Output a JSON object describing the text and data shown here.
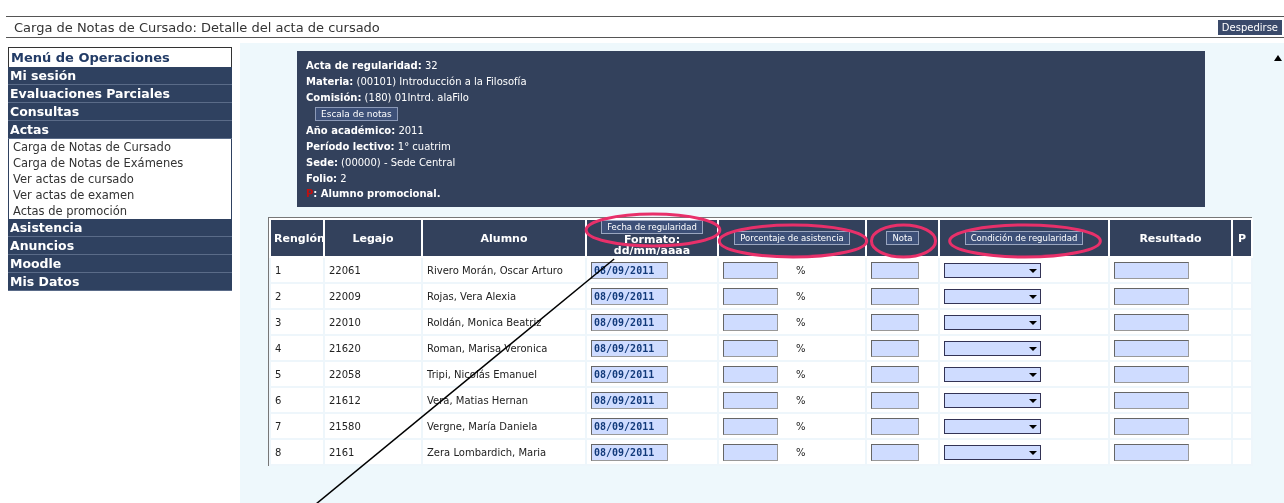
{
  "page": {
    "title": "Carga de Notas de Cursado: Detalle del acta de cursado",
    "logout_button": "Despedirse"
  },
  "sidebar": {
    "heading": "Menú de Operaciones",
    "items": [
      {
        "label": "Mi sesión",
        "kind": "section"
      },
      {
        "label": "Evaluaciones Parciales",
        "kind": "section"
      },
      {
        "label": "Consultas",
        "kind": "section"
      },
      {
        "label": "Actas",
        "kind": "section"
      },
      {
        "label": "Carga de Notas de Cursado",
        "kind": "link"
      },
      {
        "label": "Carga de Notas de Exámenes",
        "kind": "link"
      },
      {
        "label": "Ver actas de cursado",
        "kind": "link"
      },
      {
        "label": "Ver actas de examen",
        "kind": "link"
      },
      {
        "label": "Actas de promoción",
        "kind": "link"
      },
      {
        "label": "Asistencia",
        "kind": "section"
      },
      {
        "label": "Anuncios",
        "kind": "section"
      },
      {
        "label": "Moodle",
        "kind": "section"
      },
      {
        "label": "Mis Datos",
        "kind": "section"
      }
    ]
  },
  "info": {
    "lines": [
      {
        "kind": "field",
        "label": "Acta de regularidad:",
        "value": "32"
      },
      {
        "kind": "field",
        "label": "Materia:",
        "value": "(00101) Introducción a la Filosofía"
      },
      {
        "kind": "field",
        "label": "Comisión:",
        "value": "(180) 01Intrd. alaFilo"
      },
      {
        "kind": "button",
        "label": "Escala de notas"
      },
      {
        "kind": "field",
        "label": "Año académico:",
        "value": "2011"
      },
      {
        "kind": "field",
        "label": "Período lectivo:",
        "value": "1° cuatrim"
      },
      {
        "kind": "field",
        "label": "Sede:",
        "value": "(00000) - Sede Central"
      },
      {
        "kind": "field",
        "label": "Folio:",
        "value": "2"
      },
      {
        "kind": "legend",
        "mark": "P",
        "label": ": Alumno promocional."
      }
    ]
  },
  "table": {
    "columns": [
      {
        "kind": "text",
        "label": "Renglón"
      },
      {
        "kind": "text",
        "label": "Legajo"
      },
      {
        "kind": "text",
        "label": "Alumno"
      },
      {
        "kind": "button",
        "button": "Fecha de regularidad",
        "label": "Formato:",
        "sublabel": "dd/mm/aaaa"
      },
      {
        "kind": "button",
        "button": "Porcentaje de asistencia"
      },
      {
        "kind": "button",
        "button": "Nota"
      },
      {
        "kind": "button",
        "button": "Condición de regularidad"
      },
      {
        "kind": "text",
        "label": "Resultado"
      },
      {
        "kind": "text",
        "label": "P"
      }
    ],
    "rows": [
      {
        "renglon": "1",
        "legajo": "22061",
        "alumno": "Rivero Morán, Oscar Arturo",
        "fecha": "08/09/2011",
        "unit": "%"
      },
      {
        "renglon": "2",
        "legajo": "22009",
        "alumno": "Rojas, Vera Alexia",
        "fecha": "08/09/2011",
        "unit": "%"
      },
      {
        "renglon": "3",
        "legajo": "22010",
        "alumno": "Roldán, Monica Beatriz",
        "fecha": "08/09/2011",
        "unit": "%"
      },
      {
        "renglon": "4",
        "legajo": "21620",
        "alumno": "Roman, Marisa Veronica",
        "fecha": "08/09/2011",
        "unit": "%"
      },
      {
        "renglon": "5",
        "legajo": "22058",
        "alumno": "Tripi, Nicolás Emanuel",
        "fecha": "08/09/2011",
        "unit": "%"
      },
      {
        "renglon": "6",
        "legajo": "21612",
        "alumno": "Vera, Matias Hernan",
        "fecha": "08/09/2011",
        "unit": "%"
      },
      {
        "renglon": "7",
        "legajo": "21580",
        "alumno": "Vergne, María Daniela",
        "fecha": "08/09/2011",
        "unit": "%"
      },
      {
        "renglon": "8",
        "legajo": "2161",
        "alumno": "Zera Lombardich, Maria",
        "fecha": "08/09/2011",
        "unit": "%"
      }
    ]
  }
}
